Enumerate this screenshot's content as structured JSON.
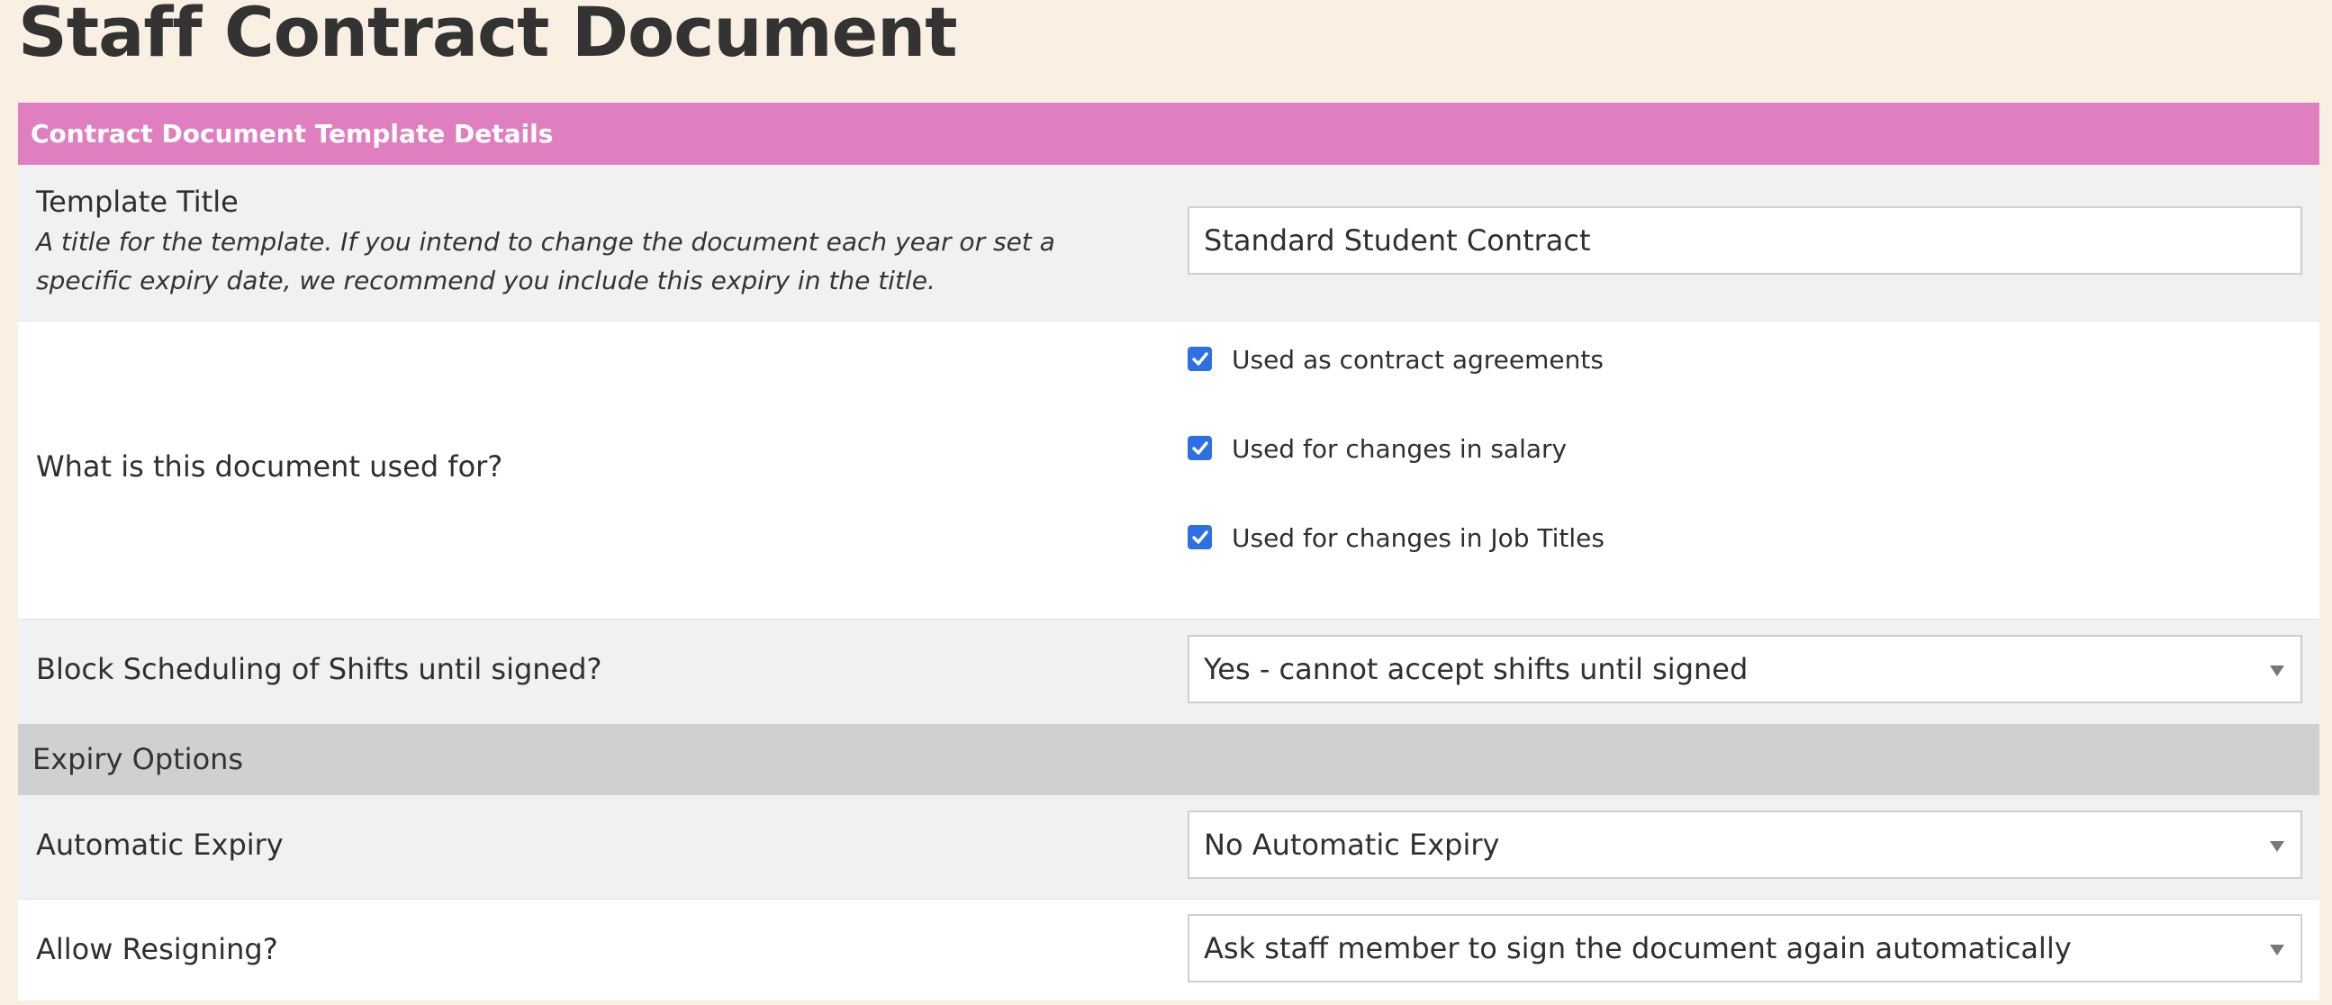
{
  "page": {
    "title": "Staff Contract Document"
  },
  "section": {
    "title": "Contract Document Template Details"
  },
  "template_title": {
    "label": "Template Title",
    "help": "A title for the template. If you intend to change the document each year or set a specific expiry date, we recommend you include this expiry in the title.",
    "value": "Standard Student Contract"
  },
  "usage": {
    "label": "What is this document used for?",
    "options": [
      {
        "label": "Used as contract agreements",
        "checked": true
      },
      {
        "label": "Used for changes in salary",
        "checked": true
      },
      {
        "label": "Used for changes in Job Titles",
        "checked": true
      }
    ]
  },
  "block_scheduling": {
    "label": "Block Scheduling of Shifts until signed?",
    "selected": "Yes - cannot accept shifts until signed"
  },
  "expiry_section": {
    "title": "Expiry Options"
  },
  "automatic_expiry": {
    "label": "Automatic Expiry",
    "selected": "No Automatic Expiry"
  },
  "allow_resigning": {
    "label": "Allow Resigning?",
    "selected": "Ask staff member to sign the document again automatically"
  },
  "colors": {
    "page_background": "#f9f0e3",
    "section_header": "#df7fbf",
    "checkbox_accent": "#2f6fe4",
    "subsection_header": "#d0d0d0"
  }
}
